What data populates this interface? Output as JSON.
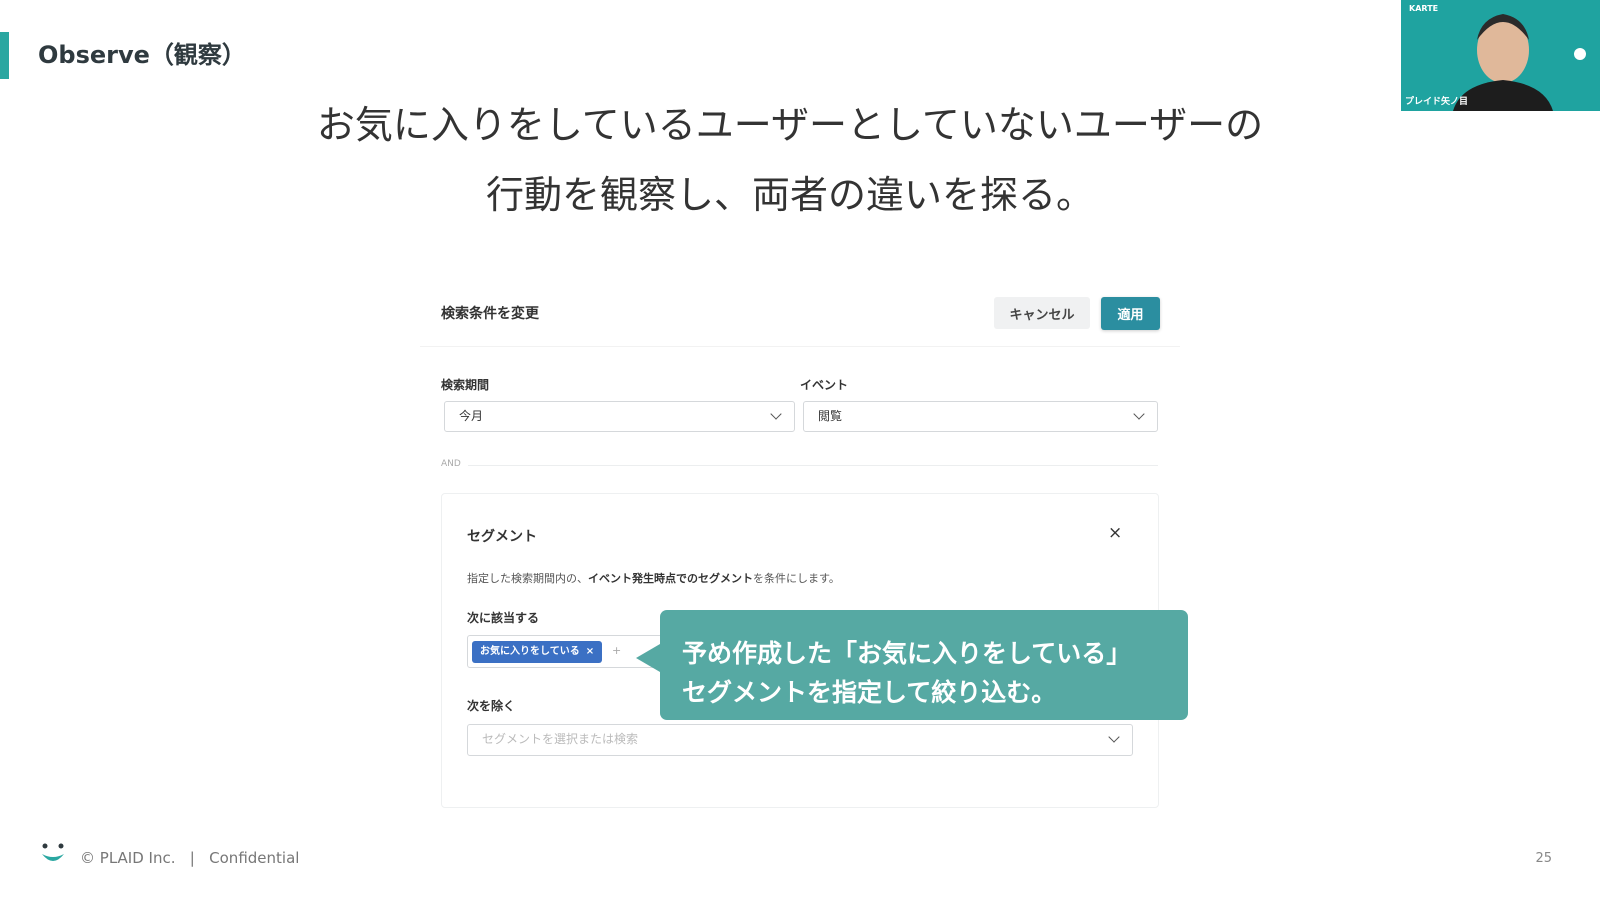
{
  "slide": {
    "section_title": "Observe（観察）",
    "headline_line1": "お気に入りをしているユーザーとしていないユーザーの",
    "headline_line2": "行動を観察し、両者の違いを探る。",
    "page_number": "25"
  },
  "video": {
    "brand": "KARTE",
    "presenter_name": "プレイド矢ノ目"
  },
  "panel": {
    "title": "検索条件を変更",
    "cancel_label": "キャンセル",
    "apply_label": "適用",
    "period": {
      "label": "検索期間",
      "value": "今月"
    },
    "event": {
      "label": "イベント",
      "value": "閲覧"
    },
    "and_label": "AND"
  },
  "segment": {
    "title": "セグメント",
    "close_glyph": "×",
    "desc_prefix": "指定した検索期間内の、",
    "desc_bold": "イベント発生時点でのセグメント",
    "desc_suffix": "を条件にします。",
    "include_label": "次に該当する",
    "tag_label": "お気に入りをしている",
    "tag_remove": "×",
    "add_glyph": "+",
    "exclude_label": "次を除く",
    "exclude_placeholder": "セグメントを選択または検索"
  },
  "callout": {
    "line1": "予め作成した「お気に入りをしている」",
    "line2": "セグメントを指定して絞り込む。"
  },
  "footer": {
    "copyright": "© PLAID Inc.",
    "separator": "|",
    "confidential": "Confidential"
  },
  "colors": {
    "accent": "#2aa7a1",
    "apply_button": "#2b8ea0",
    "tag": "#3b70c4",
    "callout": "#56a9a3"
  }
}
